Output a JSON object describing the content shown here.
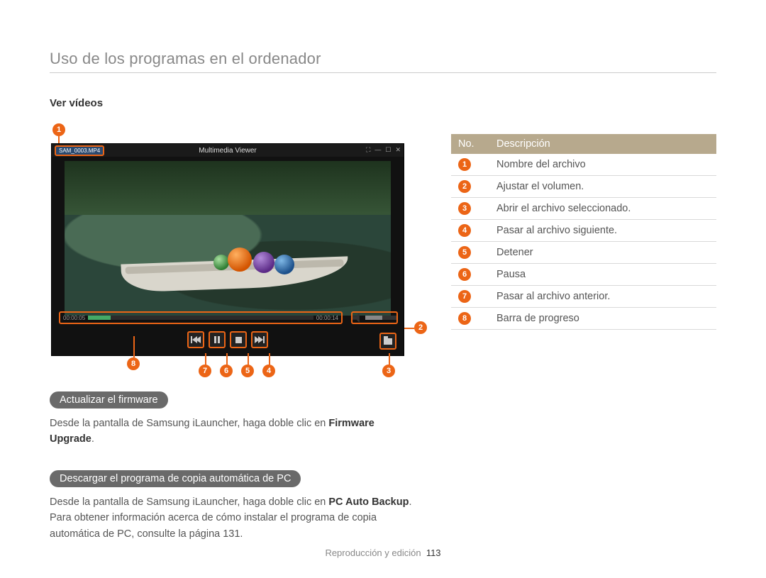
{
  "page": {
    "title": "Uso de los programas en el ordenador",
    "footer_section": "Reproducción y edición",
    "footer_page": "113"
  },
  "left": {
    "subtitle": "Ver vídeos",
    "player": {
      "filename": "SAM_0003.MP4",
      "app_title": "Multimedia Viewer",
      "time_elapsed": "00:00:05",
      "time_total": "00:00:14"
    },
    "firmware": {
      "pill": "Actualizar el firmware",
      "text_a": "Desde la pantalla de Samsung iLauncher, haga doble clic en ",
      "text_b": "Firmware Upgrade",
      "text_c": "."
    },
    "backup": {
      "pill": "Descargar el programa de copia automática de PC",
      "text_a": "Desde la pantalla de Samsung iLauncher, haga doble clic en ",
      "text_b": "PC Auto Backup",
      "text_c": ". Para obtener información acerca de cómo instalar el programa de copia automática de PC, consulte la página 131."
    }
  },
  "table": {
    "head_no": "No.",
    "head_desc": "Descripción",
    "rows": [
      {
        "n": "1",
        "d": "Nombre del archivo"
      },
      {
        "n": "2",
        "d": "Ajustar el volumen."
      },
      {
        "n": "3",
        "d": "Abrir el archivo seleccionado."
      },
      {
        "n": "4",
        "d": "Pasar al archivo siguiente."
      },
      {
        "n": "5",
        "d": "Detener"
      },
      {
        "n": "6",
        "d": "Pausa"
      },
      {
        "n": "7",
        "d": "Pasar al archivo anterior."
      },
      {
        "n": "8",
        "d": "Barra de progreso"
      }
    ]
  },
  "callouts": {
    "c1": "1",
    "c2": "2",
    "c3": "3",
    "c4": "4",
    "c5": "5",
    "c6": "6",
    "c7": "7",
    "c8": "8"
  }
}
